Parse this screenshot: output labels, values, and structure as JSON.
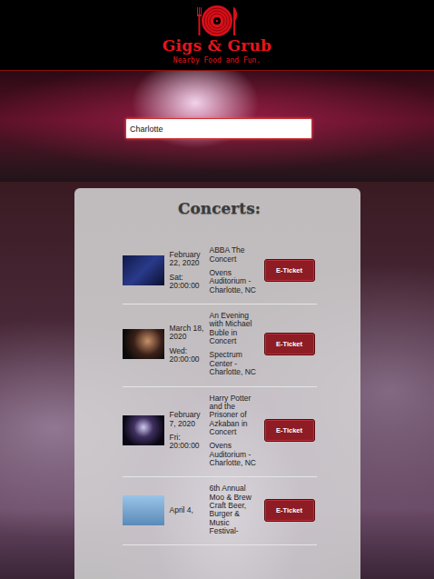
{
  "logo": {
    "title": "Gigs & Grub",
    "tagline": "Nearby Food and Fun."
  },
  "search": {
    "value": "Charlotte"
  },
  "concerts": {
    "heading": "Concerts:",
    "items": [
      {
        "date": "February 22, 2020",
        "time": "Sat: 20:00:00",
        "name": "ABBA The Concert",
        "venue": "Ovens Auditorium - Charlotte, NC",
        "button": "E-Ticket"
      },
      {
        "date": "March 18, 2020",
        "time": "Wed: 20:00:00",
        "name": "An Evening with Michael Buble in Concert",
        "venue": "Spectrum Center - Charlotte, NC",
        "button": "E-Ticket"
      },
      {
        "date": "February 7, 2020",
        "time": "Fri: 20:00:00",
        "name": "Harry Potter and the Prisoner of Azkaban in Concert",
        "venue": "Ovens Auditorium - Charlotte, NC",
        "button": "E-Ticket"
      },
      {
        "date": "April 4,",
        "name": "6th Annual Moo & Brew Craft Beer, Burger & Music Festival-",
        "button": "E-Ticket"
      }
    ]
  }
}
